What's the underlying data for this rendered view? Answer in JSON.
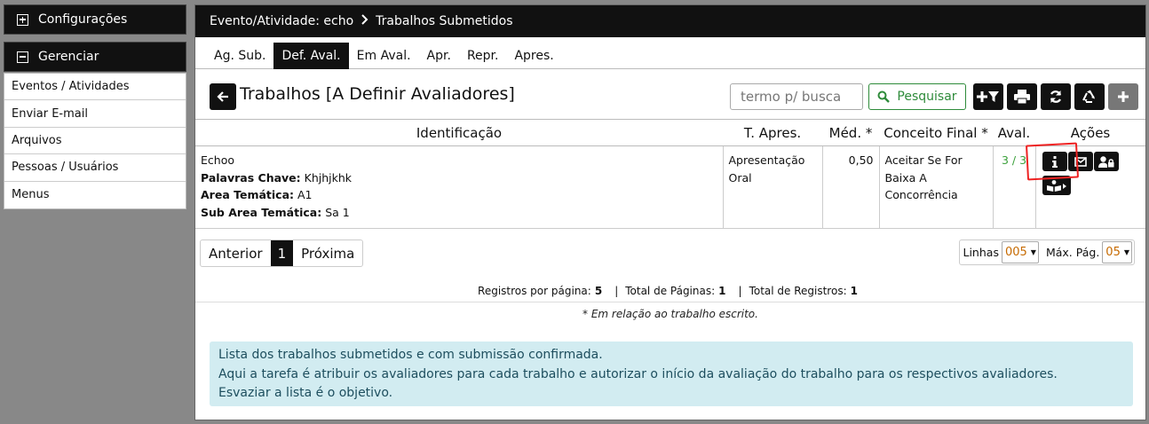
{
  "sidebar": {
    "config_label": "Configurações",
    "manage_label": "Gerenciar",
    "items": [
      {
        "label": "Eventos / Atividades"
      },
      {
        "label": "Enviar E-mail"
      },
      {
        "label": "Arquivos"
      },
      {
        "label": "Pessoas / Usuários"
      },
      {
        "label": "Menus"
      }
    ]
  },
  "header": {
    "breadcrumb_event": "Evento/Atividade: echo",
    "breadcrumb_page": "Trabalhos Submetidos"
  },
  "tabs": [
    {
      "label": "Ag. Sub."
    },
    {
      "label": "Def. Aval.",
      "active": true
    },
    {
      "label": "Em Aval."
    },
    {
      "label": "Apr."
    },
    {
      "label": "Repr."
    },
    {
      "label": "Apres."
    }
  ],
  "main": {
    "title": "Trabalhos [A Definir Avaliadores]",
    "search_placeholder": "termo p/ busca",
    "search_button": "Pesquisar"
  },
  "table": {
    "headers": [
      "Identificação",
      "T. Apres.",
      "Méd. *",
      "Conceito Final *",
      "Aval.",
      "Ações"
    ],
    "rows": [
      {
        "title": "Echoo",
        "keywords_label": "Palavras Chave:",
        "keywords": "Khjhjkhk",
        "area_label": "Area Temática:",
        "area": "A1",
        "subarea_label": "Sub Area Temática:",
        "subarea": "Sa 1",
        "presentation": "Apresentação Oral",
        "average": "0,50",
        "final_concept": "Aceitar Se For Baixa A Concorrência",
        "evaluations": "3 / 3"
      }
    ]
  },
  "pagination": {
    "prev": "Anterior",
    "current": "1",
    "next": "Próxima",
    "lines_label": "Linhas",
    "lines_value": "005",
    "max_pages_label": "Máx. Pág.",
    "max_pages_value": "05"
  },
  "stats": {
    "per_page_label": "Registros por página:",
    "per_page": "5",
    "total_pages_label": "Total de Páginas:",
    "total_pages": "1",
    "total_records_label": "Total de Registros:",
    "total_records": "1",
    "separator": "|",
    "footnote": "* Em relação ao trabalho escrito."
  },
  "info": {
    "lines": [
      "Lista dos trabalhos submetidos e com submissão confirmada.",
      "Aqui a tarefa é atribuir os avaliadores para cada trabalho e autorizar o início da avaliação do trabalho para os respectivos avaliadores.",
      "Esvaziar a lista é o objetivo."
    ]
  },
  "colors": {
    "dark": "#111111",
    "accent_green": "#2e8b3a",
    "info_bg": "#d2ecf1",
    "annotation_red": "#e22222"
  }
}
